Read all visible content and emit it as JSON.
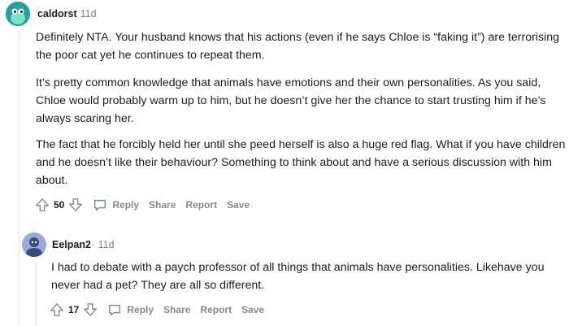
{
  "comment1": {
    "author": "caldorst",
    "time": "· 11d",
    "paragraphs": [
      "Definitely NTA. Your husband knows that his actions (even if he says Chloe is “faking it”) are terrorising the poor cat yet he continues to repeat them.",
      "It’s pretty common knowledge that animals have emotions and their own personalities. As you said, Chloe would probably warm up to him, but he doesn’t give her the chance to start trusting him if he’s always scaring her.",
      "The fact that he forcibly held her until she peed herself is also a huge red flag. What if you have children and he doesn’t like their behaviour? Something to think about and have a serious discussion with him about."
    ],
    "score": "50",
    "actions": {
      "reply": "Reply",
      "share": "Share",
      "report": "Report",
      "save": "Save"
    },
    "avatar_color": "#24a0a0"
  },
  "comment2": {
    "author": "Eelpan2",
    "time": "· 11d",
    "text": "I had to debate with a paych professor of all things that animals have personalities. Likehave you never had a pet? They are all so different.",
    "score": "17",
    "actions": {
      "reply": "Reply",
      "share": "Share",
      "report": "Report",
      "save": "Save"
    },
    "avatar_color": "#9aa9d8"
  },
  "icons": [
    "upvote-icon",
    "downvote-icon",
    "reply-icon",
    "avatar-icon"
  ]
}
